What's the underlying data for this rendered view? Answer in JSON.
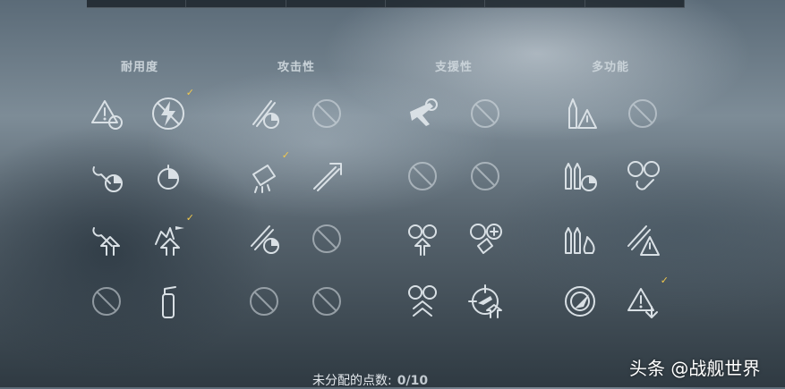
{
  "categories": [
    {
      "title": "耐用度",
      "skills": [
        {
          "icon": "fire-warning-target-icon",
          "selected": false
        },
        {
          "icon": "no-lightning-icon",
          "selected": true
        },
        {
          "icon": "wrench-timer-icon",
          "selected": false
        },
        {
          "icon": "timer-icon",
          "selected": false
        },
        {
          "icon": "wrench-upgrade-icon",
          "selected": false
        },
        {
          "icon": "ship-aa-upgrade-icon",
          "selected": true
        },
        {
          "icon": "locked-slot-icon",
          "selected": false
        },
        {
          "icon": "fire-extinguisher-icon",
          "selected": false
        }
      ]
    },
    {
      "title": "攻击性",
      "skills": [
        {
          "icon": "torpedo-timer-icon",
          "selected": false
        },
        {
          "icon": "locked-slot-icon",
          "selected": false
        },
        {
          "icon": "shell-burst-icon",
          "selected": true
        },
        {
          "icon": "torpedo-range-icon",
          "selected": false
        },
        {
          "icon": "torpedo-reload-icon",
          "selected": false
        },
        {
          "icon": "locked-slot-icon",
          "selected": false
        },
        {
          "icon": "locked-slot-icon",
          "selected": false
        },
        {
          "icon": "locked-slot-icon",
          "selected": false
        }
      ]
    },
    {
      "title": "支援性",
      "skills": [
        {
          "icon": "aircraft-target-icon",
          "selected": false
        },
        {
          "icon": "locked-slot-icon",
          "selected": false
        },
        {
          "icon": "locked-slot-icon",
          "selected": false
        },
        {
          "icon": "locked-slot-icon",
          "selected": false
        },
        {
          "icon": "aa-upgrade-icon",
          "selected": false
        },
        {
          "icon": "aa-plus-icon",
          "selected": false
        },
        {
          "icon": "aa-double-upgrade-icon",
          "selected": false
        },
        {
          "icon": "aircraft-crosshair-upgrade-icon",
          "selected": false
        }
      ]
    },
    {
      "title": "多功能",
      "skills": [
        {
          "icon": "shell-warning-icon",
          "selected": false
        },
        {
          "icon": "locked-slot-icon",
          "selected": false
        },
        {
          "icon": "shells-timer-icon",
          "selected": false
        },
        {
          "icon": "radiation-wrench-icon",
          "selected": false
        },
        {
          "icon": "shells-fire-icon",
          "selected": false
        },
        {
          "icon": "torpedo-warning-icon",
          "selected": false
        },
        {
          "icon": "radar-icon",
          "selected": false
        },
        {
          "icon": "warning-download-icon",
          "selected": true
        }
      ]
    }
  ],
  "footer": {
    "label": "未分配的点数:",
    "value": "0/10"
  },
  "watermark": {
    "text": "头条 @战舰世界"
  },
  "colors": {
    "selected_check": "#f2c94c",
    "icon": "#d9e0e5"
  }
}
